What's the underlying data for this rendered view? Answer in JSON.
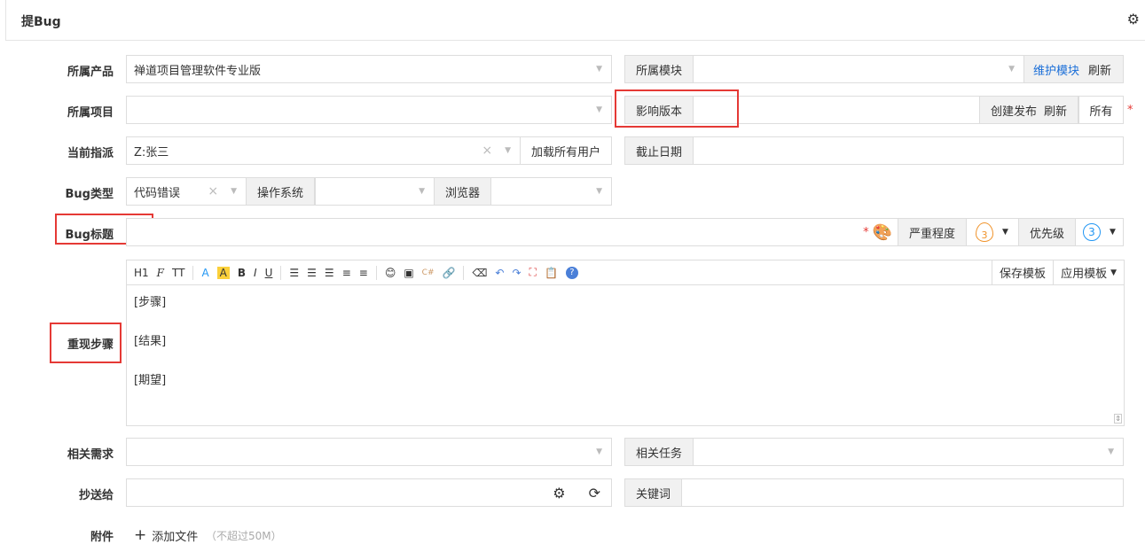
{
  "title": "提Bug",
  "labels": {
    "product": "所属产品",
    "project": "所属项目",
    "assign": "当前指派",
    "type": "Bug类型",
    "bugtitle": "Bug标题",
    "steps": "重现步骤",
    "story": "相关需求",
    "mailto": "抄送给",
    "files": "附件"
  },
  "product": {
    "value": "禅道项目管理软件专业版"
  },
  "module": {
    "label": "所属模块",
    "maintain": "维护模块",
    "refresh": "刷新"
  },
  "build": {
    "label": "影响版本",
    "create": "创建发布",
    "refresh": "刷新",
    "all": "所有"
  },
  "assign": {
    "value": "Z:张三",
    "load_all": "加载所有用户"
  },
  "deadline": {
    "label": "截止日期"
  },
  "type": {
    "value": "代码错误",
    "os_label": "操作系统",
    "browser_label": "浏览器"
  },
  "severity": {
    "label": "严重程度",
    "value": "3",
    "color": "#f0932b"
  },
  "priority": {
    "label": "优先级",
    "value": "3",
    "color": "#2196f3"
  },
  "editor": {
    "toolbar": [
      "H1",
      "F",
      "TT",
      "A",
      "A",
      "B",
      "I",
      "U"
    ],
    "save_template": "保存模板",
    "apply_template": "应用模板",
    "lines": [
      "[步骤]",
      "[结果]",
      "[期望]"
    ]
  },
  "task": {
    "label": "相关任务"
  },
  "keywords": {
    "label": "关键词"
  },
  "files": {
    "add": "添加文件",
    "hint": "（不超过50M）"
  },
  "required": "*"
}
